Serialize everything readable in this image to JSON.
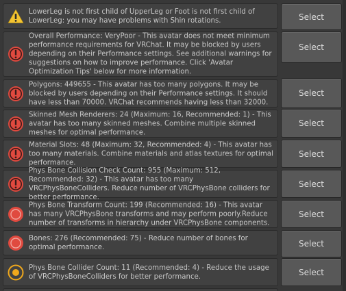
{
  "select_label": "Select",
  "colors": {
    "warning_yellow": "#f4c431",
    "error_red": "#e04a3f",
    "orange_ring": "#f0a81c"
  },
  "rows": [
    {
      "icon": "warning-triangle-icon",
      "text": "LowerLeg is not first child of UpperLeg or Foot is not first child of LowerLeg: you may have problems with Shin rotations."
    },
    {
      "icon": "error-exclamation-icon",
      "text": "Overall Performance: VeryPoor - This avatar does not meet minimum performance requirements for VRChat. It may be blocked by users depending on their Performance settings. See additional warnings for suggestions on how to improve performance. Click 'Avatar Optimization Tips' below for more information."
    },
    {
      "icon": "error-exclamation-icon",
      "text": "Polygons: 449655 - This avatar has too many polygons. It may be blocked by users depending on their Performance settings. It should have less than 70000. VRChat recommends having less than 32000."
    },
    {
      "icon": "error-exclamation-icon",
      "text": "Skinned Mesh Renderers: 24 (Maximum: 16, Recommended: 1) - This avatar has too many skinned meshes. Combine multiple skinned meshes for optimal performance."
    },
    {
      "icon": "error-exclamation-icon",
      "text": "Material Slots: 48 (Maximum: 32, Recommended: 4) - This avatar has too many materials. Combine materials and atlas textures for optimal performance."
    },
    {
      "icon": "error-exclamation-icon",
      "text": "Phys Bone Collision Check Count: 955 (Maximum: 512, Recommended: 32) - This avatar has too many VRCPhysBoneColliders. Reduce number of VRCPhysBone colliders for better performance."
    },
    {
      "icon": "red-circle-icon",
      "text": "Phys Bone Transform Count: 199 (Recommended: 16) - This avatar has many VRCPhysBone transforms and may perform poorly.Reduce number of transforms in hierarchy under VRCPhysBone components."
    },
    {
      "icon": "red-circle-icon",
      "text": "Bones: 276 (Recommended: 75) - Reduce number of bones for optimal performance."
    },
    {
      "icon": "orange-ring-icon",
      "text": "Phys Bone Collider Count: 11 (Recommended: 4) - Reduce the usage of VRCPhysBoneColliders for better performance."
    }
  ]
}
